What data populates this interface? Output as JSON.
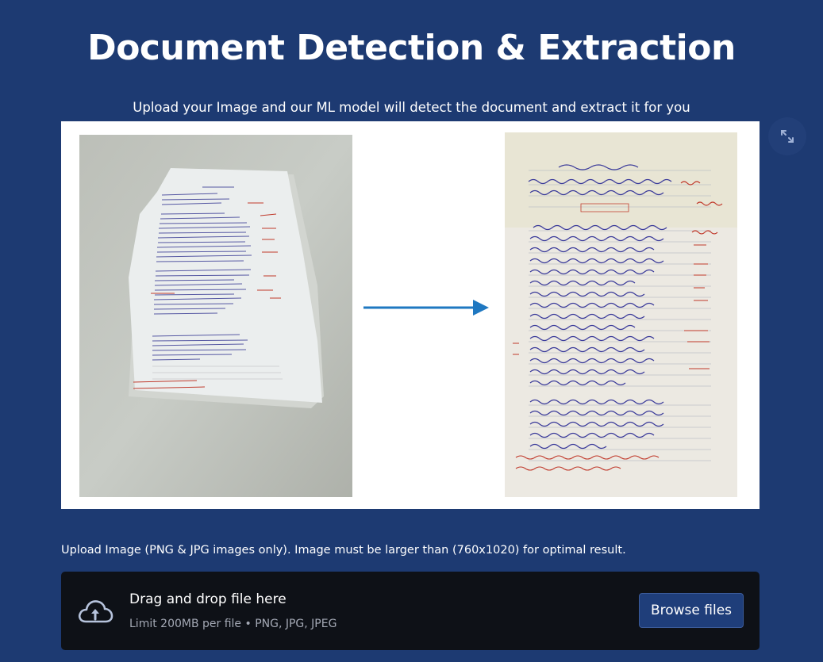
{
  "header": {
    "title": "Document Detection & Extraction",
    "subtitle": "Upload your Image and our ML model will detect the document and extract it for you"
  },
  "result_panel": {
    "fullscreen_icon": "expand-arrows-icon",
    "original_image_alt": "Photo of handwritten document on table",
    "extracted_image_alt": "Extracted and cropped document",
    "arrow_icon": "right-arrow-icon",
    "arrow_color": "#1f78c1"
  },
  "uploader": {
    "label": "Upload Image (PNG & JPG images only). Image must be larger than (760x1020) for optimal result.",
    "drop_text": "Drag and drop file here",
    "limit_text": "Limit 200MB per file • PNG, JPG, JPEG",
    "browse_label": "Browse files",
    "icon": "cloud-upload-icon"
  },
  "colors": {
    "background": "#1d3a72",
    "dropzone": "#0e1117",
    "button": "#1f3e7a",
    "ink_blue": "#3a3a9a",
    "ink_red": "#c0392b"
  }
}
